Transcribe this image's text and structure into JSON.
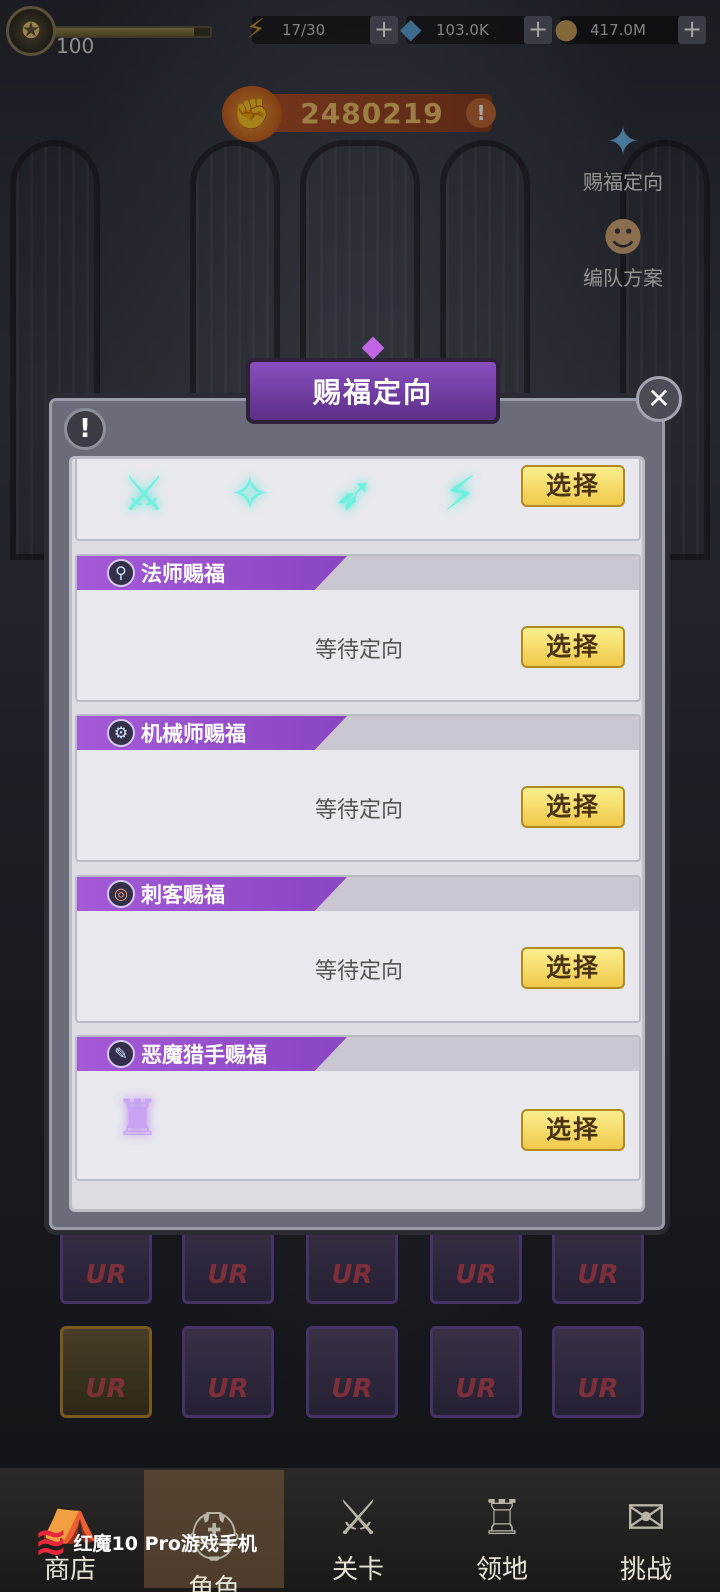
{
  "topbar": {
    "level": "100",
    "level_progress": 0.9,
    "energy": "17/30",
    "diamonds": "103.0K",
    "gold": "417.0M"
  },
  "power": {
    "value": "2480219"
  },
  "side": {
    "blessing_label": "赐福定向",
    "formation_label": "编队方案"
  },
  "modal": {
    "title": "赐福定向",
    "rows": [
      {
        "name": "",
        "status": "",
        "button": "选择",
        "icons": [
          "sword-blessing-icon",
          "gun-blessing-icon",
          "arrow-blessing-icon",
          "bullet-blessing-icon"
        ]
      },
      {
        "name": "法师赐福",
        "status": "等待定向",
        "button": "选择"
      },
      {
        "name": "机械师赐福",
        "status": "等待定向",
        "button": "选择"
      },
      {
        "name": "刺客赐福",
        "status": "等待定向",
        "button": "选择"
      },
      {
        "name": "恶魔猎手赐福",
        "status": "",
        "button": "选择"
      }
    ]
  },
  "heroes": [
    "UR",
    "UR",
    "UR",
    "UR",
    "UR",
    "UR",
    "UR",
    "UR",
    "UR",
    "UR"
  ],
  "nav": {
    "shop": "商店",
    "role": "角色",
    "stage": "关卡",
    "territory": "领地",
    "challenge": "挑战"
  },
  "watermark": "红魔10 Pro游戏手机"
}
